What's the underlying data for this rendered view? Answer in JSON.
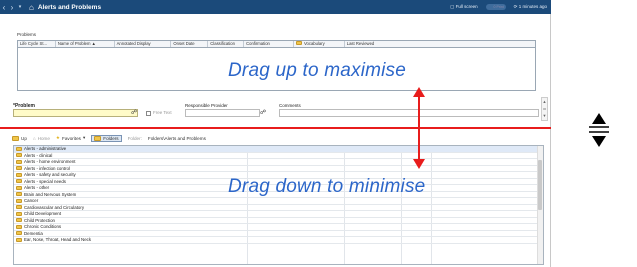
{
  "titlebar": {
    "title": "Alerts and Problems",
    "full_screen": "Full screen",
    "print_label": "0 Print",
    "refresh": "1 minutes ago"
  },
  "problems": {
    "section_label": "Problems",
    "columns": [
      "Life Cycle St...",
      "Name of Problem ▲",
      "Annotated Display",
      "Onset Date",
      "Classification",
      "Confirmation",
      "Vocabulary",
      "Last Reviewed"
    ]
  },
  "overlays": {
    "up": "Drag up to maximise",
    "down": "Drag down to minimise"
  },
  "form": {
    "problem_label": "*Problem",
    "free_text": "Free Text",
    "responsible_provider": "Responsible Provider",
    "comments": "Comments"
  },
  "toolbar": {
    "up": "Up",
    "home": "Home",
    "favorites": "Favorites",
    "folders": "Folders",
    "folder_label": "Folder:",
    "folder_path": "Folders\\Alerts and Problems"
  },
  "tree_items": [
    "Alerts - administrative",
    "Alerts - clinical",
    "Alerts - home environment",
    "Alerts - infection control",
    "Alerts - safety and security",
    "Alerts - special needs",
    "Alerts - other",
    "Brain and Nervous System",
    "Cancer",
    "Cardiovascular and Circulatory",
    "Child Development",
    "Child Protection",
    "Chronic Conditions",
    "Dementia",
    "Ear, Nose, Throat, Head and Neck"
  ],
  "colors": {
    "titlebar": "#1b4a7a",
    "overlay_text": "#2c66c9",
    "red": "#e81c1c",
    "problem_input": "#fffbc8"
  },
  "icons": [
    "back-icon",
    "forward-icon",
    "home-icon",
    "binoculars-icon",
    "folder-icon",
    "resize-icon"
  ]
}
